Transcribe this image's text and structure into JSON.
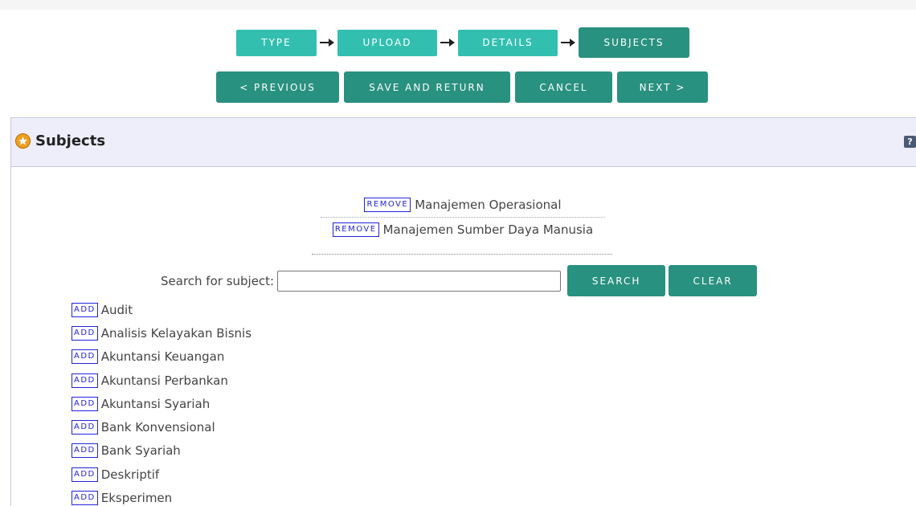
{
  "workflow": {
    "steps": [
      {
        "label": "TYPE",
        "state": "done"
      },
      {
        "label": "UPLOAD",
        "state": "done"
      },
      {
        "label": "DETAILS",
        "state": "done"
      },
      {
        "label": "SUBJECTS",
        "state": "current"
      }
    ],
    "buttons": {
      "previous": "< PREVIOUS",
      "save_return": "SAVE AND RETURN",
      "cancel": "CANCEL",
      "next": "NEXT >"
    }
  },
  "panel": {
    "title": "Subjects",
    "help": "?",
    "icon": "star-icon"
  },
  "selected": {
    "remove_label": "REMOVE",
    "items": [
      "Manajemen Operasional",
      "Manajemen Sumber Daya Manusia"
    ]
  },
  "search": {
    "label": "Search for subject:",
    "value": "",
    "search_button": "SEARCH",
    "clear_button": "CLEAR"
  },
  "options": {
    "add_label": "ADD",
    "items": [
      "Audit",
      "Analisis Kelayakan Bisnis",
      "Akuntansi Keuangan",
      "Akuntansi Perbankan",
      "Akuntansi Syariah",
      "Bank Konvensional",
      "Bank Syariah",
      "Deskriptif",
      "Eksperimen"
    ]
  },
  "colors": {
    "step_done": "#33bfb0",
    "step_current": "#29917f",
    "button": "#29917f",
    "panel_header": "#eeeefb",
    "link_blue": "#2222dd"
  }
}
